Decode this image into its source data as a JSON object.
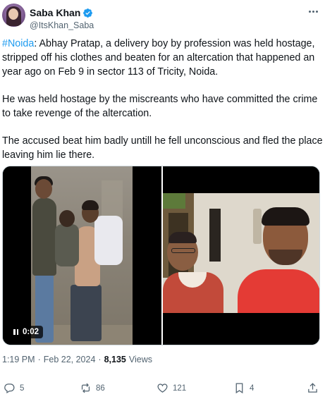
{
  "author": {
    "name": "Saba Khan",
    "handle": "@ItsKhan_Saba",
    "verified_color": "#1d9bf0"
  },
  "tweet": {
    "hashtag": "#Noida",
    "paragraph1": ": Abhay Pratap, a delivery boy by profession was held hostage, stripped off his clothes and beaten for an altercation that happened an year ago on Feb 9 in sector 113 of Tricity, Noida.",
    "paragraph2": " He was held hostage by the miscreants who have committed the crime to take revenge of the altercation.",
    "paragraph3": "The accused beat him badly untill he fell unconscious and fled the place leaving him lie there."
  },
  "media": {
    "video_time": "0:02",
    "video_icon": "pause-icon"
  },
  "meta": {
    "time": "1:19 PM",
    "separator": "·",
    "date": "Feb 22, 2024",
    "views_count": "8,135",
    "views_label": "Views"
  },
  "actions": {
    "replies": "5",
    "reposts": "86",
    "likes": "121",
    "bookmarks": "4"
  },
  "colors": {
    "link": "#1d9bf0",
    "secondary_text": "#536471",
    "primary_text": "#0f1419"
  }
}
